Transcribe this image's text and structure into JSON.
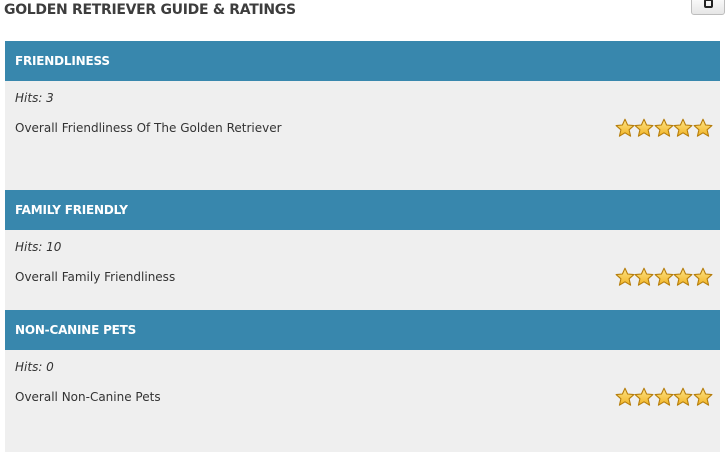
{
  "page": {
    "title": "GOLDEN RETRIEVER GUIDE & RATINGS",
    "corner_icon": "camera-icon"
  },
  "sections": [
    {
      "header": "FRIENDLINESS",
      "hits": "Hits: 3",
      "item_label": "Overall Friendliness Of The Golden Retriever",
      "rating": 5,
      "rating_max": 5
    },
    {
      "header": "FAMILY FRIENDLY",
      "hits": "Hits: 10",
      "item_label": "Overall Family Friendliness",
      "rating": 5,
      "rating_max": 5
    },
    {
      "header": "NON-CANINE PETS",
      "hits": "Hits: 0",
      "item_label": "Overall Non-Canine Pets",
      "rating": 5,
      "rating_max": 5
    }
  ],
  "colors": {
    "header_bg": "#3887ad",
    "body_bg": "#efefef",
    "star_fill": "#f0b323",
    "star_stroke": "#b57d0c"
  }
}
